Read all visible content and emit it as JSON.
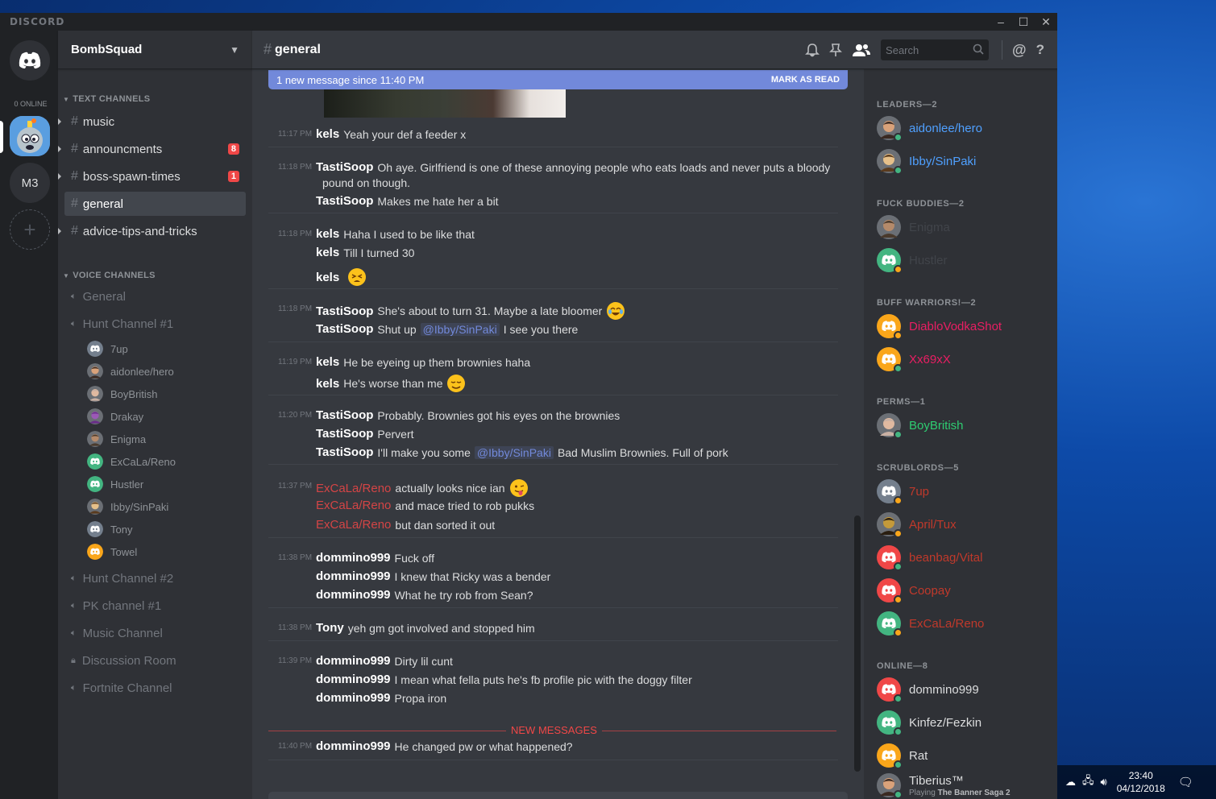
{
  "window": {
    "brand": "DISCORD",
    "minimize": "–",
    "maximize": "☐",
    "close": "✕"
  },
  "guilds": {
    "online_count": "0 ONLINE",
    "m3_label": "M3",
    "add_label": "+"
  },
  "server": {
    "name": "BombSquad"
  },
  "text_category": "TEXT CHANNELS",
  "text_channels": [
    {
      "name": "music",
      "badge": ""
    },
    {
      "name": "announcments",
      "badge": "8"
    },
    {
      "name": "boss-spawn-times",
      "badge": "1"
    },
    {
      "name": "general",
      "badge": ""
    },
    {
      "name": "advice-tips-and-tricks",
      "badge": ""
    }
  ],
  "voice_category": "VOICE CHANNELS",
  "voice_channels": {
    "general": "General",
    "hunt1": "Hunt Channel #1",
    "hunt1_users": [
      "7up",
      "aidonlee/hero",
      "BoyBritish",
      "Drakay",
      "Enigma",
      "ExCaLa/Reno",
      "Hustler",
      "Ibby/SinPaki",
      "Tony",
      "Towel"
    ],
    "hunt2": "Hunt Channel #2",
    "pk1": "PK channel #1",
    "music": "Music Channel",
    "discussion": "Discussion Room",
    "fortnite": "Fortnite Channel"
  },
  "chat": {
    "channel_name": "general",
    "search_placeholder": "Search",
    "new_bar_text": "1 new message since 11:40 PM",
    "new_bar_action": "MARK AS READ",
    "new_divider": "NEW MESSAGES"
  },
  "messages": [
    {
      "time": "11:17 PM",
      "lines": [
        {
          "author": "kels",
          "text": "Yeah your def a feeder x"
        }
      ]
    },
    {
      "time": "11:18 PM",
      "lines": [
        {
          "author": "TastiSoop",
          "text": "Oh aye. Girlfriend is one of these annoying people who eats loads and never puts a bloody"
        },
        {
          "author": "",
          "text": "pound on though."
        },
        {
          "author": "TastiSoop",
          "text": "Makes me hate her a bit"
        }
      ]
    },
    {
      "time": "11:18 PM",
      "lines": [
        {
          "author": "kels",
          "text": "Haha I used to be like that"
        },
        {
          "author": "kels",
          "text": "Till I turned 30"
        },
        {
          "author": "kels",
          "text": ""
        }
      ]
    },
    {
      "time": "11:18 PM",
      "lines": [
        {
          "author": "TastiSoop",
          "text": "She's about to turn 31. Maybe a late bloomer"
        },
        {
          "author": "TastiSoop",
          "text": "Shut up",
          "mention": "@Ibby/SinPaki",
          "after": "I see you there"
        }
      ]
    },
    {
      "time": "11:19 PM",
      "lines": [
        {
          "author": "kels",
          "text": "He be eyeing up them brownies haha"
        },
        {
          "author": "kels",
          "text": "He's worse than me"
        }
      ]
    },
    {
      "time": "11:20 PM",
      "lines": [
        {
          "author": "TastiSoop",
          "text": "Probably. Brownies got his eyes on the brownies"
        },
        {
          "author": "TastiSoop",
          "text": "Pervert"
        },
        {
          "author": "TastiSoop",
          "text": "I'll make you some",
          "mention": "@Ibby/SinPaki",
          "after": "Bad Muslim Brownies.  Full of pork"
        }
      ]
    },
    {
      "time": "11:37 PM",
      "lines": [
        {
          "author": "ExCaLa/Reno",
          "text": "actually looks nice ian"
        },
        {
          "author": "ExCaLa/Reno",
          "text": "and mace tried to rob pukks"
        },
        {
          "author": "ExCaLa/Reno",
          "text": "but dan sorted it out"
        }
      ]
    },
    {
      "time": "11:38 PM",
      "lines": [
        {
          "author": "dommino999",
          "text": "Fuck off"
        },
        {
          "author": "dommino999",
          "text": "I knew that Ricky was a bender"
        },
        {
          "author": "dommino999",
          "text": "What he try rob from Sean?"
        }
      ]
    },
    {
      "time": "11:38 PM",
      "lines": [
        {
          "author": "Tony",
          "text": "yeh gm got involved and stopped him"
        }
      ]
    },
    {
      "time": "11:39 PM",
      "lines": [
        {
          "author": "dommino999",
          "text": "Dirty lil cunt"
        },
        {
          "author": "dommino999",
          "text": "I mean what fella puts he's fb profile pic with the doggy filter"
        },
        {
          "author": "dommino999",
          "text": "Propa iron"
        }
      ]
    },
    {
      "time": "11:40 PM",
      "lines": [
        {
          "author": "dommino999",
          "text": "He changed pw or what happened?"
        }
      ]
    }
  ],
  "members": {
    "leaders": "LEADERS—2",
    "leaders_list": [
      "aidonlee/hero",
      "Ibby/SinPaki"
    ],
    "fb": "FUCK BUDDIES—2",
    "fb_list": [
      "Enigma",
      "Hustler"
    ],
    "buff": "BUFF WARRIORS!—2",
    "buff_list": [
      "DiabloVodkaShot",
      "Xx69xX"
    ],
    "perms": "PERMS—1",
    "perms_list": [
      "BoyBritish"
    ],
    "scrub": "SCRUBLORDS—5",
    "scrub_list": [
      "7up",
      "April/Tux",
      "beanbag/Vital",
      "Coopay",
      "ExCaLa/Reno"
    ],
    "online": "ONLINE—8",
    "online_list": [
      "dommino999",
      "Kinfez/Fezkin",
      "Rat",
      "Tiberius™"
    ],
    "tiberius_playing_prefix": "Playing",
    "tiberius_game": "The Banner Saga 2"
  },
  "colors": {
    "blurple": "#7289da",
    "leader": "#4fa0ff",
    "buff": "#e91e63",
    "perms": "#2ecc71",
    "scrub": "#e74c3c",
    "fb": "#3c3f45"
  },
  "tray": {
    "time": "23:40",
    "date": "04/12/2018"
  }
}
